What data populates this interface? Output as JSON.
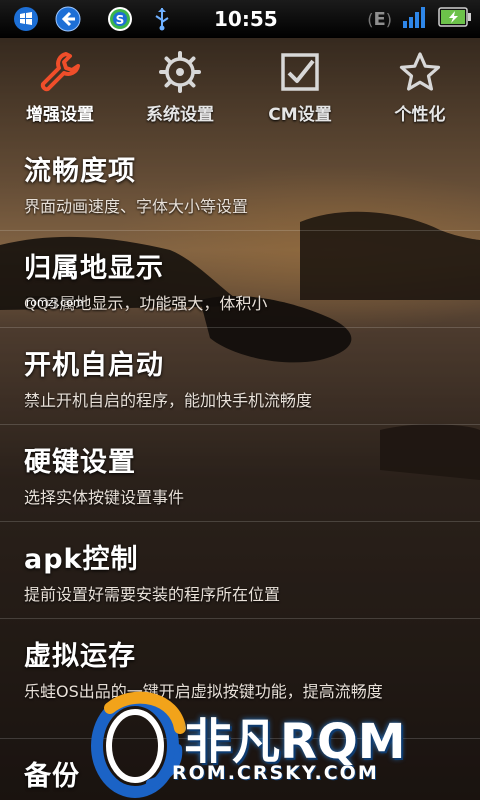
{
  "status_bar": {
    "time": "10:55",
    "network": "E",
    "icons": [
      "windows-logo-icon",
      "back-arrow-icon",
      "s-app-icon",
      "usb-icon",
      "edge-network-icon",
      "signal-bars-icon",
      "battery-charging-icon"
    ],
    "colors": {
      "accent_blue": "#1d6fd6",
      "battery_green": "#6cc24a"
    }
  },
  "tabs": [
    {
      "label": "增强设置",
      "icon": "wrench-icon",
      "active": true
    },
    {
      "label": "系统设置",
      "icon": "gear-icon",
      "active": false
    },
    {
      "label": "CM设置",
      "icon": "checkbox-icon",
      "active": false
    },
    {
      "label": "个性化",
      "icon": "star-icon",
      "active": false
    }
  ],
  "accent": "#f04e2a",
  "items": [
    {
      "title": "流畅度项",
      "subtitle": "界面动画速度、字体大小等设置"
    },
    {
      "title": "归属地显示",
      "subtitle": "QQ3属地显示，功能强大，体积小"
    },
    {
      "title": "开机自启动",
      "subtitle": "禁止开机自启的程序，能加快手机流畅度"
    },
    {
      "title": "硬键设置",
      "subtitle": "选择实体按键设置事件"
    },
    {
      "title": "apk控制",
      "subtitle": "提前设置好需要安装的程序所在位置"
    },
    {
      "title": "虚拟运存",
      "subtitle": "乐蛙OS出品的一键开启虚拟按键功能，提高流畅度"
    },
    {
      "title": "备份",
      "subtitle": ""
    }
  ],
  "watermark": {
    "small_text": "romzj.com",
    "brand": "非凡RQM",
    "url": "ROM.CRSKY.COM"
  }
}
